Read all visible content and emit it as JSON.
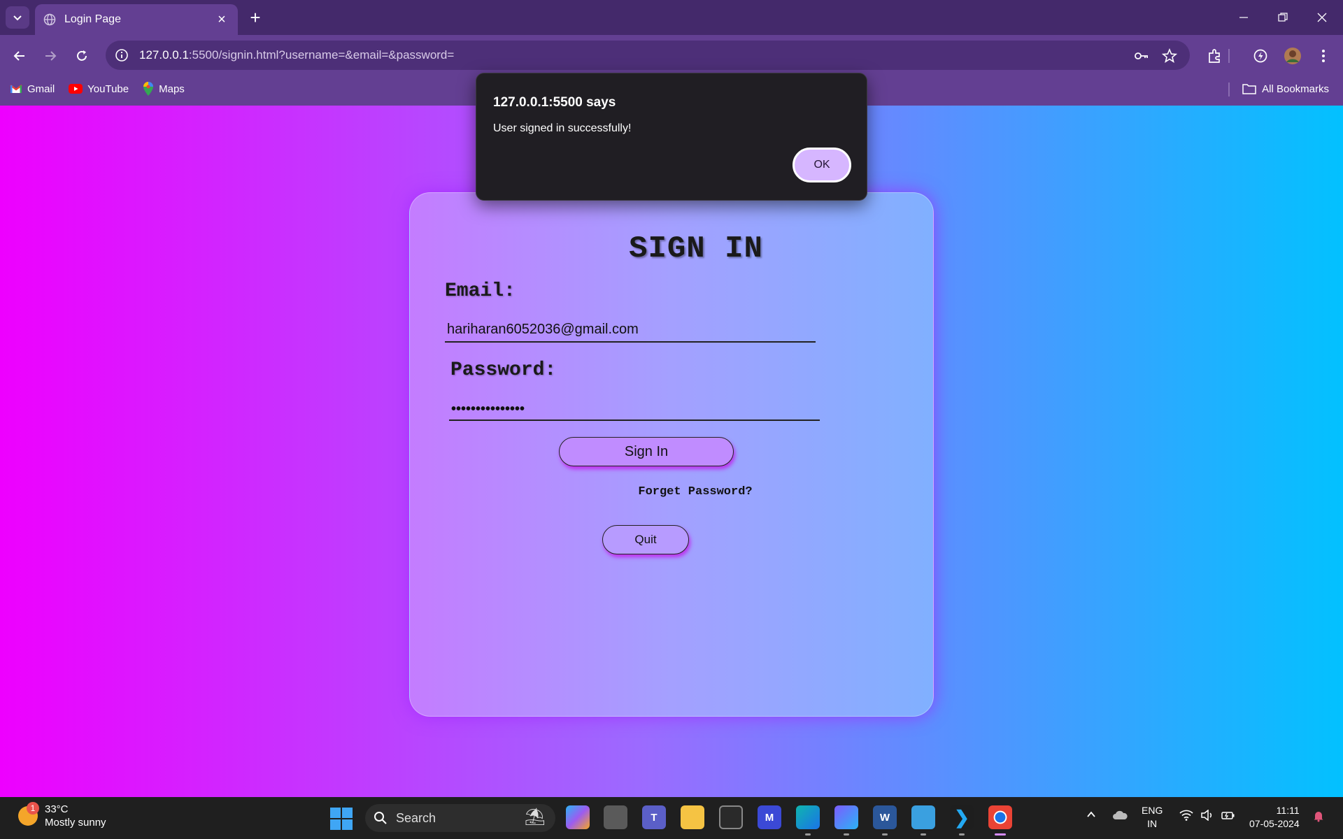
{
  "browser": {
    "tab_title": "Login Page",
    "url_host": "127.0.0.1",
    "url_path": ":5500/signin.html?username=&email=&password=",
    "bookmarks": [
      "Gmail",
      "YouTube",
      "Maps"
    ],
    "all_bookmarks": "All Bookmarks"
  },
  "dialog": {
    "title": "127.0.0.1:5500 says",
    "message": "User signed in successfully!",
    "ok_label": "OK"
  },
  "form": {
    "title": "SIGN IN",
    "email_label": "Email:",
    "email_value": "hariharan6052036@gmail.com",
    "password_label": "Password:",
    "password_mask": "•••••••••••••••",
    "signin_label": "Sign In",
    "forget_label": "Forget Password?",
    "quit_label": "Quit"
  },
  "taskbar": {
    "weather_temp": "33°C",
    "weather_desc": "Mostly sunny",
    "weather_badge": "1",
    "search_placeholder": "Search",
    "lang_top": "ENG",
    "lang_bottom": "IN",
    "time": "11:11",
    "date": "07-05-2024"
  },
  "colors": {
    "page_gradient": [
      "#ee00ff",
      "#9b6bff",
      "#02c1ff"
    ],
    "chrome_purple": "#633f92",
    "dialog_bg": "#201e23",
    "ok_button": "#d6b6ff"
  }
}
